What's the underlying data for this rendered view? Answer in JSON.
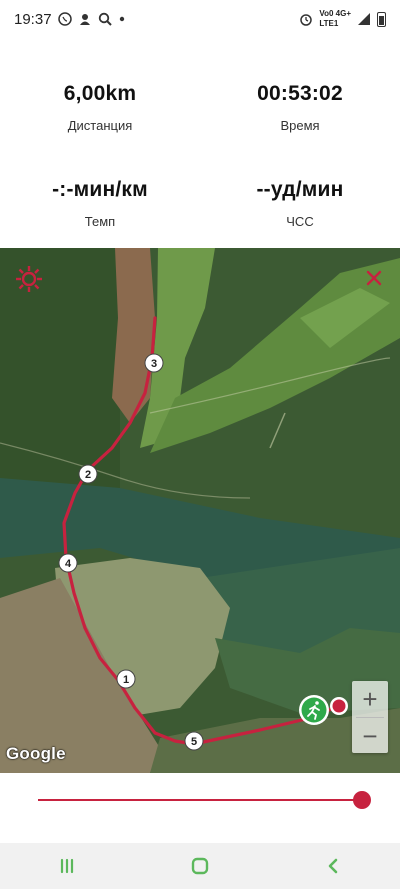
{
  "status_bar": {
    "time": "19:37",
    "network": "Vo0 4G+\nLTE1",
    "icons": [
      "viber-icon",
      "messenger-icon",
      "search-icon",
      "dot-icon",
      "alarm-icon",
      "signal-icon",
      "battery-icon"
    ]
  },
  "stats": {
    "distance": {
      "value": "6,00km",
      "label": "Дистанция"
    },
    "time": {
      "value": "00:53:02",
      "label": "Время"
    },
    "pace": {
      "value": "-:-мин/км",
      "label": "Темп"
    },
    "heart_rate": {
      "value": "--уд/мин",
      "label": "ЧСС"
    }
  },
  "map": {
    "attribution": "Google",
    "route_color": "#c7223f",
    "markers": [
      "1",
      "2",
      "3",
      "4",
      "5"
    ],
    "zoom_in": "+",
    "zoom_out": "−"
  },
  "slider": {
    "progress": 1.0,
    "color": "#c7223f"
  },
  "nav_bar": {
    "accent": "#5cb85c",
    "items": [
      "recents-icon",
      "home-icon",
      "back-icon"
    ]
  }
}
